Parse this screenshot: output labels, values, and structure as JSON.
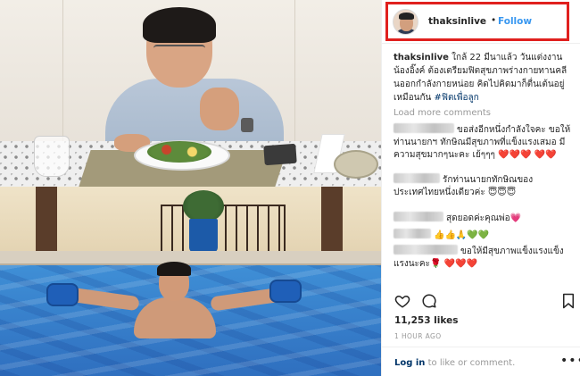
{
  "post": {
    "username": "thaksinlive",
    "separator": "•",
    "follow_label": "Follow",
    "caption_user": "thaksinlive",
    "caption_text": "ใกล้ 22 มีนาแล้ว วันแต่งงานน้องอิ๊งค์ ต้องเตรียมฟิตสุขภาพร่างกายทานคลีนออกกำลังกายหน่อย คิดไปคิดมาก็ตื่นเต้นอยู่เหมือนกัน",
    "caption_hashtag": "#ฟิตเพื่อลูก",
    "load_more_label": "Load more comments",
    "likes": "11,253 likes",
    "time": "1 HOUR AGO",
    "login_link": "Log in",
    "login_rest": "to like or comment.",
    "more_label": "•••"
  },
  "comments": [
    {
      "text": "ขอส่งอีกหนึ่งกำลังใจคะ ขอให้ท่านนายกฯ ทักษิณมีสุขภาพที่แข็งแรงเสมอ มีความสุขมากๆนะคะ เย้ๆๆๆ ❤️❤️❤️ ❤️❤️"
    },
    {
      "text": "รักท่านนายกทักษิณของประเทศไทยหนึ่งเดียวค่ะ 😇😇😇"
    },
    {
      "text": "สุดยอดค่ะคุณพ่อ💗"
    },
    {
      "text": "👍👍🙏💚💚"
    },
    {
      "text": "ขอให้มีสุขภาพแข็งแรงแข็งแรงนะคะ🌹 ❤️❤️❤️"
    }
  ],
  "icons": {
    "heart": "heart-icon",
    "comment": "comment-icon",
    "save": "bookmark-icon"
  },
  "colors": {
    "highlight_border": "#e0201e",
    "follow_blue": "#3897f0",
    "link_navy": "#003569",
    "muted": "#999999",
    "heart_red": "#ed1c24"
  }
}
